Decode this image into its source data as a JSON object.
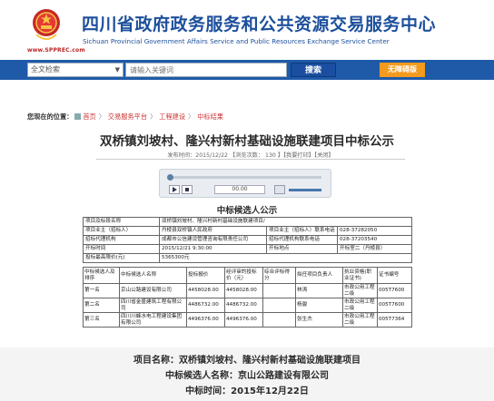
{
  "header": {
    "title": "四川省政府政务服务和公共资源交易服务中心",
    "subtitle": "Sichuan Provincial Government Affairs Service and Public Resources Exchange Service Center",
    "url": "www.SPPREC.com"
  },
  "search": {
    "category": "全文检索",
    "placeholder": "请输入关键词",
    "button": "搜索",
    "barrier_free": "无障碍版"
  },
  "breadcrumb": {
    "label": "您现在的位置：",
    "items": [
      "首页",
      "交易服务平台",
      "工程建设",
      "中标结果"
    ]
  },
  "article": {
    "title": "双桥镇刘坡村、隆兴村新村基础设施联建项目中标公示",
    "meta": "发布时间：2015/12/22    【浏览次数： 130 】【我要打印】【关闭】"
  },
  "player": {
    "time": "00.00",
    "progress": 0,
    "volume": 0.85
  },
  "notice": {
    "section_title": "中标候选人公示",
    "table_title": ""
  },
  "info_table": {
    "project_name_label": "项目及标段名称",
    "project_name": "双桥镇刘坡村、隆兴村新村基础设施联建项目/",
    "owner_label": "项目业主（招标人）",
    "owner": "丹棱县双桥镇人民政府",
    "owner_phone_label": "项目业主（招标人）联系电话",
    "owner_phone": "028-37282050",
    "agent_label": "招标代理机构",
    "agent": "成都市公信建设管理咨询有限责任公司",
    "agent_phone_label": "招标代理机构联系电话",
    "agent_phone": "028-37203540",
    "open_time_label": "开标时间",
    "open_time": "2015/12/21 9:30:00",
    "open_place_label": "开标地点",
    "open_place": "开标室二（丹棱县）",
    "max_price_label": "投标最高限价(元)",
    "max_price": "5365300元"
  },
  "bid_table": {
    "headers": [
      "中标候选人及排序",
      "中标候选人名称",
      "投标报价",
      "经评审的投标价（元）",
      "综合评标得分",
      "拟任项目负责人",
      "执业资格(职业证书)",
      "证书编号"
    ],
    "rows": [
      {
        "rank": "第一名",
        "name": "京山公路建设有限公司",
        "price": "4458028.00",
        "review_price": "4458028.00",
        "score": "",
        "manager": "林涛",
        "cert": "市政公用工程二级",
        "cert_no": "005T7600"
      },
      {
        "rank": "第二名",
        "name": "四川省金盛建筑工程有限公司",
        "price": "4486732.00",
        "review_price": "4486732.00",
        "score": "",
        "manager": "杨骏",
        "cert": "市政公用工程二级",
        "cert_no": "005T7600"
      },
      {
        "rank": "第三名",
        "name": "四川川蜂水电工程建设集团有限公司",
        "price": "4496376.00",
        "review_price": "4496376.00",
        "score": "",
        "manager": "张生杰",
        "cert": "市政公用工程二级",
        "cert_no": "005T7364"
      }
    ]
  },
  "summary": {
    "project_line": "项目名称：双桥镇刘坡村、隆兴村新村基础设施联建项目",
    "winner_line": "中标候选人名称：京山公路建设有限公司",
    "time_line": "中标时间：2015年12月22日"
  },
  "colors": {
    "brand_blue": "#1c4f9c",
    "search_bar": "#1f5aa8",
    "accent_orange": "#f39a1f"
  }
}
